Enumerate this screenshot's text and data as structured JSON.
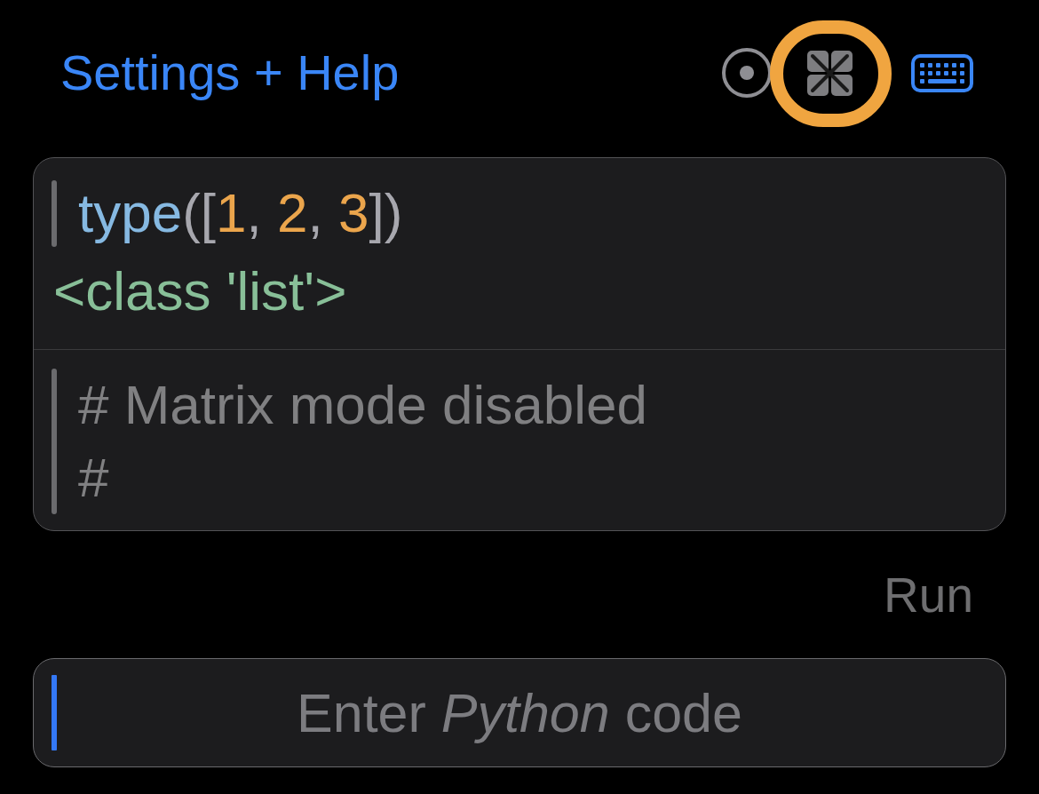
{
  "header": {
    "link": "Settings + Help"
  },
  "toolbar": [
    {
      "kind": "circle_dot",
      "on": false,
      "highlighted": false
    },
    {
      "kind": "matrix",
      "on": false,
      "highlighted": true
    },
    {
      "kind": "keyboard",
      "on": true,
      "highlighted": false
    }
  ],
  "console": {
    "history": [
      {
        "kind": "input",
        "tokens": [
          {
            "kind": "name",
            "text": "type"
          },
          {
            "kind": "punct",
            "text": "(["
          },
          {
            "kind": "number",
            "text": "1"
          },
          {
            "kind": "punct",
            "text": ", "
          },
          {
            "kind": "number",
            "text": "2"
          },
          {
            "kind": "punct",
            "text": ", "
          },
          {
            "kind": "number",
            "text": "3"
          },
          {
            "kind": "punct",
            "text": "])"
          }
        ]
      },
      {
        "kind": "output",
        "text": "<class 'list'>"
      }
    ],
    "comment_lines": [
      "# Matrix mode disabled",
      "#"
    ]
  },
  "run_button": {
    "label": "Run",
    "disabled": true
  },
  "input": {
    "placeholder": "Enter *Python* code",
    "focused": true
  }
}
